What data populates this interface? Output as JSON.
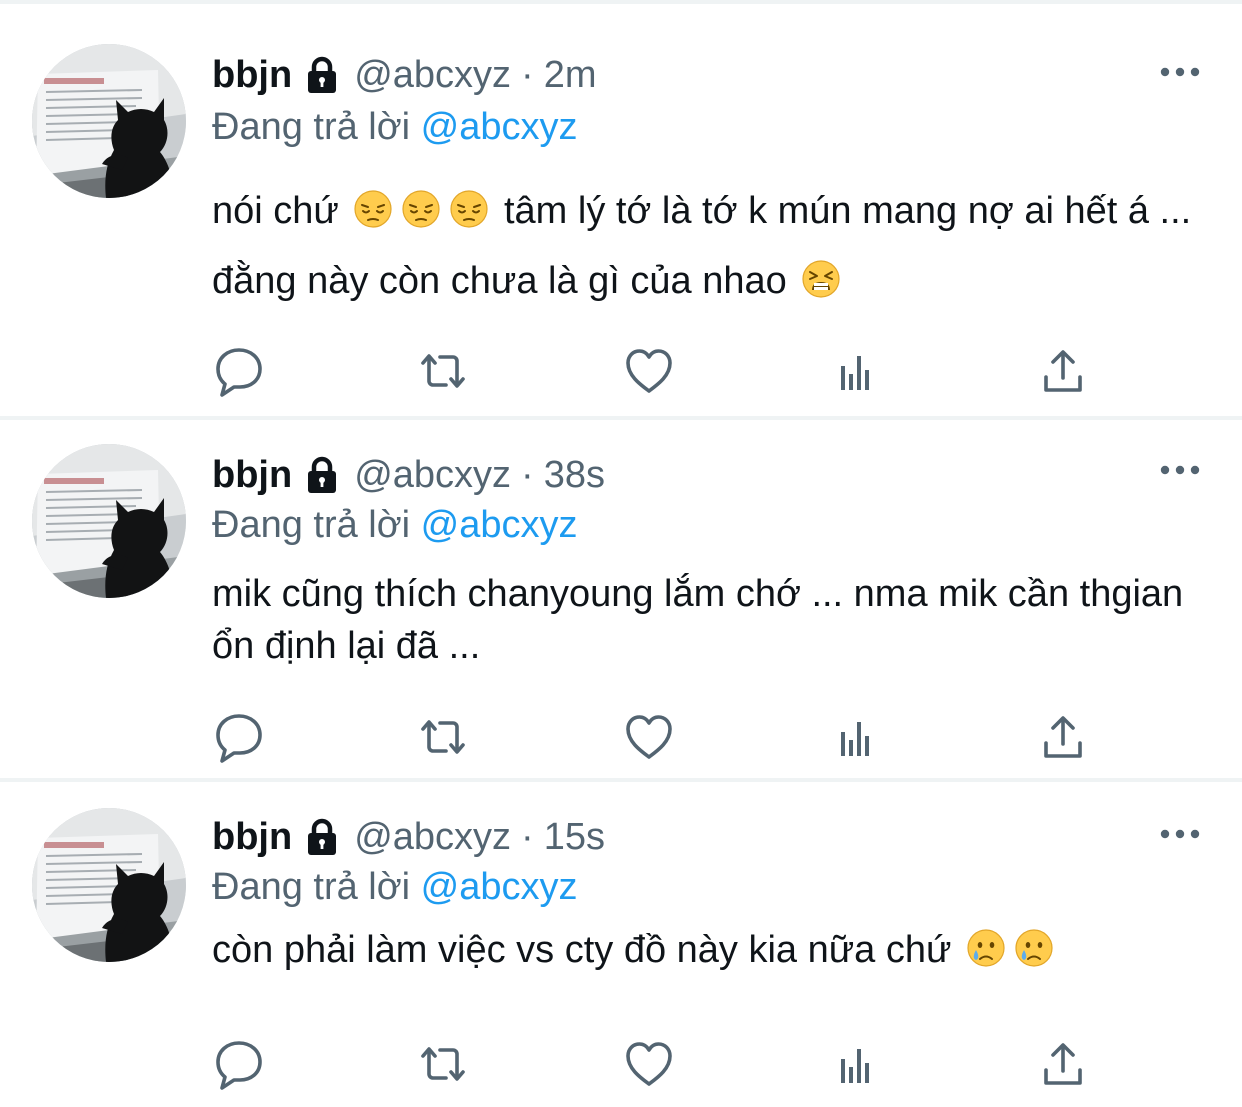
{
  "tweets": [
    {
      "author": {
        "name": "bbjn",
        "handle": "@abcxyz",
        "protected": true,
        "avatar": "cat-silhouette-at-laptop"
      },
      "time": "2m",
      "reply_prefix": "Đang trả lời",
      "reply_to": "@abcxyz",
      "text_parts": [
        "nói chứ",
        " tâm lý tớ là tớ k mún mang nợ ai hết á ... đằng này còn chưa là gì của nhao"
      ],
      "emojis": [
        "pensive-face-emoji",
        "pensive-face-emoji",
        "pensive-face-emoji",
        "tired-face-emoji"
      ]
    },
    {
      "author": {
        "name": "bbjn",
        "handle": "@abcxyz",
        "protected": true,
        "avatar": "cat-silhouette-at-laptop"
      },
      "time": "38s",
      "reply_prefix": "Đang trả lời",
      "reply_to": "@abcxyz",
      "text": "mik cũng thích chanyoung lắm chớ ... nma mik cần thgian ổn định lại đã ..."
    },
    {
      "author": {
        "name": "bbjn",
        "handle": "@abcxyz",
        "protected": true,
        "avatar": "cat-silhouette-at-laptop"
      },
      "time": "15s",
      "reply_prefix": "Đang trả lời",
      "reply_to": "@abcxyz",
      "text": "còn phải làm việc vs cty đồ này kia nữa chứ",
      "emojis": [
        "crying-face-emoji",
        "crying-face-emoji"
      ]
    }
  ],
  "separator": "·",
  "actions": [
    "reply-icon",
    "retweet-icon",
    "like-icon",
    "stats-icon",
    "share-icon"
  ],
  "colors": {
    "text": "#0f1419",
    "secondary": "#536471",
    "link": "#1d9bf0",
    "divider": "#eff3f4"
  }
}
